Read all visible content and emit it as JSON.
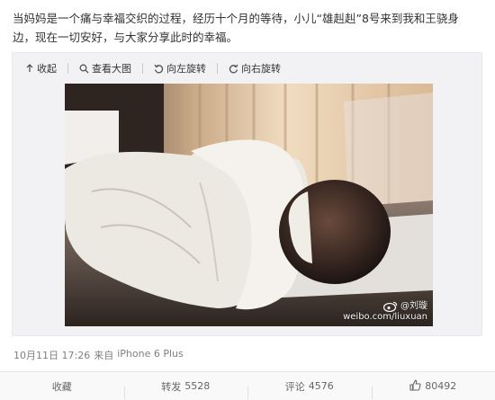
{
  "post": {
    "text": "当妈妈是一个痛与幸福交织的过程，经历十个月的等待，小儿“雄赳赳”8号来到我和王骁身边，现在一切安好，与大家分享此时的幸福。"
  },
  "toolbar": {
    "collapse": "收起",
    "view_large": "查看大图",
    "rotate_left": "向左旋转",
    "rotate_right": "向右旋转"
  },
  "watermark": {
    "handle": "@刘璇",
    "site": "weibo.com/liuxuan"
  },
  "meta": {
    "time": "10月11日 17:26",
    "source_prefix": "来自",
    "source": "iPhone 6 Plus"
  },
  "actions": {
    "favorite": "收藏",
    "repost_label": "转发",
    "repost_count": "5528",
    "comment_label": "评论",
    "comment_count": "4576",
    "like_count": "80492"
  },
  "colors": {
    "text": "#333333",
    "muted": "#808080",
    "toolbar_bg": "#f2f2f5"
  }
}
